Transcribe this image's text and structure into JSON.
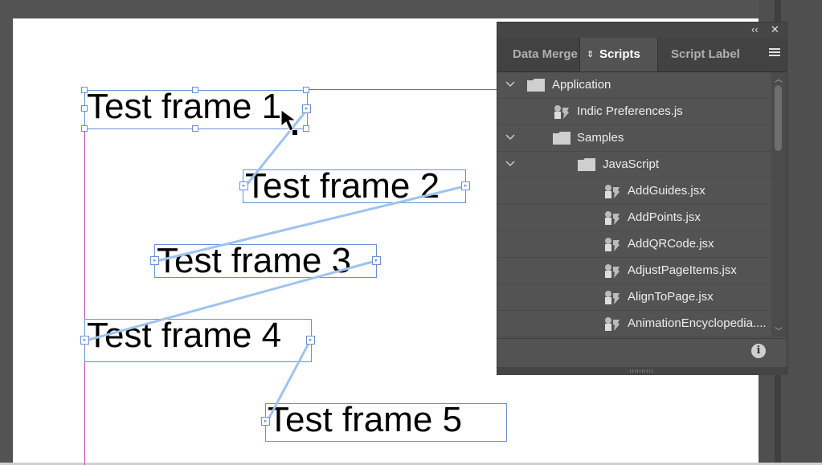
{
  "canvas": {
    "frames": [
      {
        "text": "Test frame 1"
      },
      {
        "text": "Test frame 2"
      },
      {
        "text": "Test frame 3"
      },
      {
        "text": "Test frame 4"
      },
      {
        "text": "Test frame 5"
      }
    ],
    "thread_color": "#9fc3f0",
    "frame_color": "#6b8fd6",
    "margin_color": "#c040c0"
  },
  "panel": {
    "collapse_label": "‹‹",
    "close_label": "✕",
    "tabs": [
      {
        "label": "Data Merge"
      },
      {
        "label": "Scripts"
      },
      {
        "label": "Script Label"
      }
    ],
    "active_tab": "Scripts",
    "menu_icon": "hamburger-menu-icon",
    "info_label": "i",
    "tree": [
      {
        "label": "Application",
        "kind": "folder",
        "expanded": true
      },
      {
        "label": "Indic Preferences.js",
        "kind": "script"
      },
      {
        "label": "Samples",
        "kind": "folder",
        "expanded": true
      },
      {
        "label": "JavaScript",
        "kind": "folder",
        "expanded": true
      },
      {
        "label": "AddGuides.jsx",
        "kind": "script"
      },
      {
        "label": "AddPoints.jsx",
        "kind": "script"
      },
      {
        "label": "AddQRCode.jsx",
        "kind": "script"
      },
      {
        "label": "AdjustPageItems.jsx",
        "kind": "script"
      },
      {
        "label": "AlignToPage.jsx",
        "kind": "script"
      },
      {
        "label": "AnimationEncyclopedia....",
        "kind": "script"
      }
    ]
  }
}
